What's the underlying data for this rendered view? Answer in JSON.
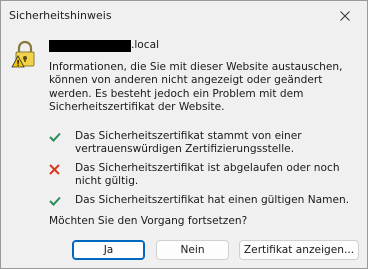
{
  "window": {
    "title": "Sicherheitshinweis"
  },
  "header": {
    "host_suffix": ".local"
  },
  "message": {
    "intro": "Informationen, die Sie mit dieser Website austauschen, können von anderen nicht angezeigt oder geändert werden. Es besteht jedoch ein Problem mit dem Sicherheitszertifikat der Website."
  },
  "checks": [
    {
      "status": "ok",
      "icon": "green-check-icon",
      "text": "Das Sicherheitszertifikat stammt von einer vertrauenswürdigen Zertifizierungsstelle."
    },
    {
      "status": "error",
      "icon": "red-x-icon",
      "text": "Das Sicherheitszertifikat ist abgelaufen oder noch nicht gültig."
    },
    {
      "status": "ok",
      "icon": "green-check-icon",
      "text": "Das Sicherheitszertifikat hat einen gültigen Namen."
    }
  ],
  "question": "Möchten Sie den Vorgang fortsetzen?",
  "buttons": {
    "yes": "Ja",
    "no": "Nein",
    "view_cert": "Zertifikat anzeigen..."
  },
  "colors": {
    "ok": "#2e8b57",
    "error": "#d9381e",
    "accent": "#0067c0"
  }
}
